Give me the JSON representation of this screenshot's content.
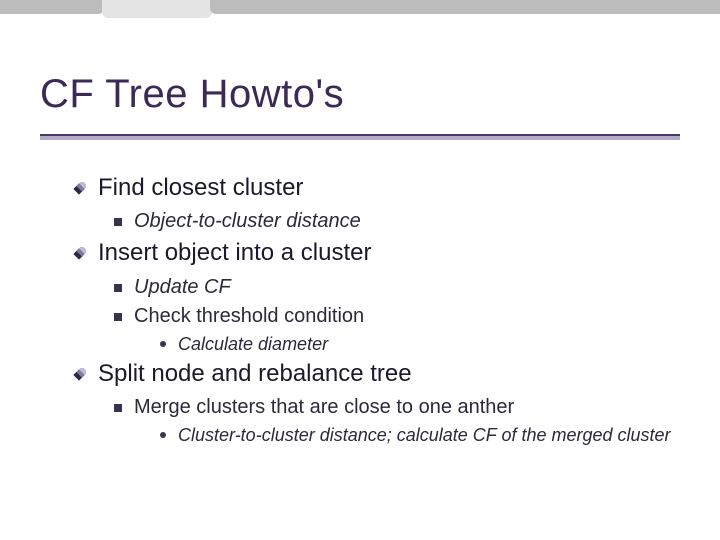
{
  "title": "CF Tree Howto's",
  "items": {
    "i1": "Find closest cluster",
    "i1a": "Object-to-cluster distance",
    "i2": "Insert object into a cluster",
    "i2a": "Update CF",
    "i2b": "Check threshold condition",
    "i2b1": "Calculate diameter",
    "i3": "Split node and rebalance tree",
    "i3a": "Merge clusters that are close to one anther",
    "i3a1": "Cluster-to-cluster distance; calculate CF of the merged cluster"
  }
}
